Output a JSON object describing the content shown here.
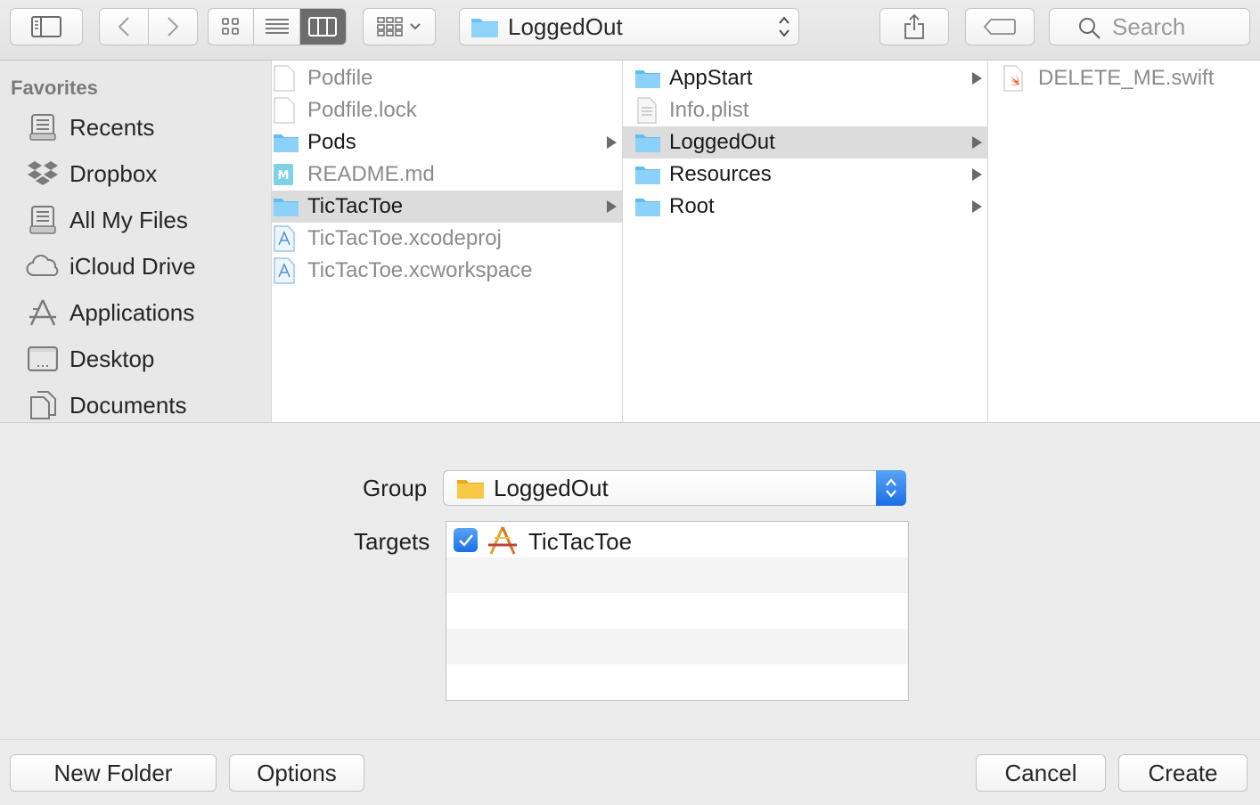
{
  "toolbar": {
    "path_popup_label": "LoggedOut",
    "search_placeholder": "Search"
  },
  "sidebar": {
    "heading": "Favorites",
    "items": [
      {
        "label": "Recents",
        "icon": "recents-icon"
      },
      {
        "label": "Dropbox",
        "icon": "dropbox-icon"
      },
      {
        "label": "All My Files",
        "icon": "all-my-files-icon"
      },
      {
        "label": "iCloud Drive",
        "icon": "icloud-icon"
      },
      {
        "label": "Applications",
        "icon": "applications-icon"
      },
      {
        "label": "Desktop",
        "icon": "desktop-icon"
      },
      {
        "label": "Documents",
        "icon": "documents-icon"
      }
    ]
  },
  "column1": {
    "rows": [
      {
        "name": "Podfile",
        "type": "file",
        "dim": true
      },
      {
        "name": "Podfile.lock",
        "type": "file",
        "dim": true
      },
      {
        "name": "Pods",
        "type": "folder",
        "dim": false
      },
      {
        "name": "README.md",
        "type": "markdown",
        "dim": true
      },
      {
        "name": "TicTacToe",
        "type": "folder",
        "dim": false,
        "selected": true
      },
      {
        "name": "TicTacToe.xcodeproj",
        "type": "xcode",
        "dim": true
      },
      {
        "name": "TicTacToe.xcworkspace",
        "type": "xcode",
        "dim": true
      }
    ]
  },
  "column2": {
    "rows": [
      {
        "name": "AppStart",
        "type": "folder",
        "dim": false
      },
      {
        "name": "Info.plist",
        "type": "plist",
        "dim": true
      },
      {
        "name": "LoggedOut",
        "type": "folder",
        "dim": false,
        "selected": true
      },
      {
        "name": "Resources",
        "type": "folder",
        "dim": false
      },
      {
        "name": "Root",
        "type": "folder",
        "dim": false
      }
    ]
  },
  "column3": {
    "rows": [
      {
        "name": "DELETE_ME.swift",
        "type": "swift",
        "dim": true
      }
    ]
  },
  "form": {
    "group_label": "Group",
    "group_value": "LoggedOut",
    "targets_label": "Targets",
    "targets": [
      {
        "name": "TicTacToe",
        "checked": true
      }
    ]
  },
  "footer": {
    "new_folder": "New Folder",
    "options": "Options",
    "cancel": "Cancel",
    "create": "Create"
  },
  "colors": {
    "folder_blue": "#6cc3f6",
    "folder_yellow": "#f6c343",
    "accent_blue": "#1a6fe5",
    "selection_gray": "#dcdcdc"
  }
}
